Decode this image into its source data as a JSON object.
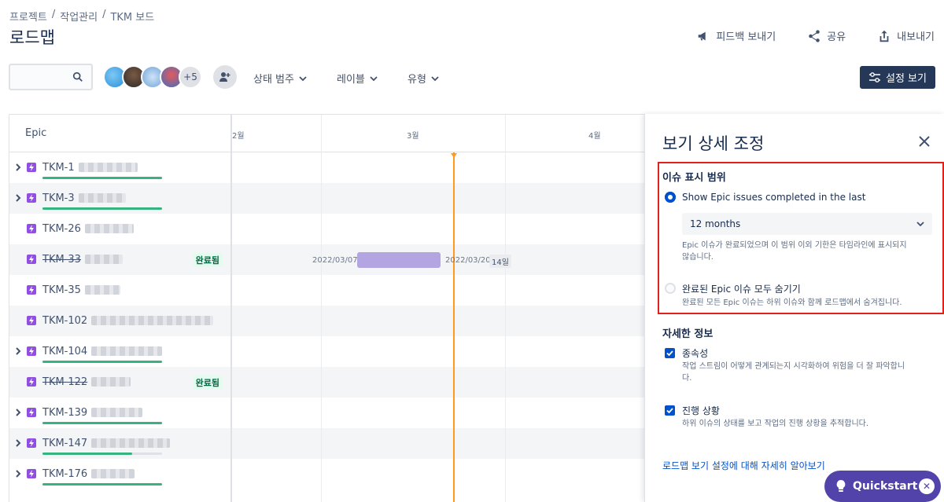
{
  "breadcrumb": [
    "프로젝트",
    "작업관리",
    "TKM 보드"
  ],
  "page_title": "로드맵",
  "header_actions": {
    "feedback": "피드백 보내기",
    "share": "공유",
    "export": "내보내기"
  },
  "toolbar": {
    "search_value": "",
    "more_avatars": "+5",
    "filters": [
      "상태 범주",
      "레이블",
      "유형"
    ],
    "view_settings": "설정 보기"
  },
  "roadmap": {
    "epic_header": "Epic",
    "months": [
      "2월",
      "3월",
      "4월"
    ],
    "done_label": "완료됨",
    "epics": [
      {
        "key": "TKM-1",
        "expandable": true,
        "done": false,
        "progress": 1.0
      },
      {
        "key": "TKM-3",
        "expandable": true,
        "done": false,
        "progress": 1.0
      },
      {
        "key": "TKM-26",
        "expandable": false,
        "done": false
      },
      {
        "key": "TKM-33",
        "expandable": false,
        "done": true
      },
      {
        "key": "TKM-35",
        "expandable": false,
        "done": false
      },
      {
        "key": "TKM-102",
        "expandable": false,
        "done": false
      },
      {
        "key": "TKM-104",
        "expandable": true,
        "done": false,
        "progress": 1.0
      },
      {
        "key": "TKM-122",
        "expandable": false,
        "done": true
      },
      {
        "key": "TKM-139",
        "expandable": true,
        "done": false,
        "progress": 1.0
      },
      {
        "key": "TKM-147",
        "expandable": true,
        "done": false,
        "progress": 0.75
      },
      {
        "key": "TKM-176",
        "expandable": true,
        "done": false,
        "progress": 1.0
      }
    ],
    "bar": {
      "start_date": "2022/03/07",
      "end_date": "2022/03/20",
      "duration": "14일"
    }
  },
  "panel": {
    "title": "보기 상세 조정",
    "issue_scope_title": "이슈 표시 범위",
    "option1_label": "Show Epic issues completed in the last",
    "select_value": "12 months",
    "option1_desc_1": "Epic 이슈가 완료되었으며 이 범위 이외 기한은 타임라인에 표시되지",
    "option1_desc_2": "않습니다.",
    "option2_label": "완료된 Epic 이슈 모두 숨기기",
    "option2_desc": "완료된 모든 Epic 이슈는 하위 이슈와 함께 로드맵에서 숨겨집니다.",
    "details_title": "자세한 정보",
    "dep_label": "종속성",
    "dep_desc_1": "작업 스트림이 어떻게 관계되는지 시각화하여 위험을 더 잘 파악합니",
    "dep_desc_2": "다.",
    "progress_label": "진행 상황",
    "progress_desc": "하위 이슈의 상태를 보고 작업의 진행 상황을 추적합니다.",
    "learn_more": "로드맵 보기 설정에 대해 자세히 알아보기"
  },
  "quickstart": "Quickstart",
  "colors": {
    "accent": "#0052cc",
    "epic": "#904ee2",
    "today": "#ff991f",
    "highlight": "#e0201b"
  }
}
